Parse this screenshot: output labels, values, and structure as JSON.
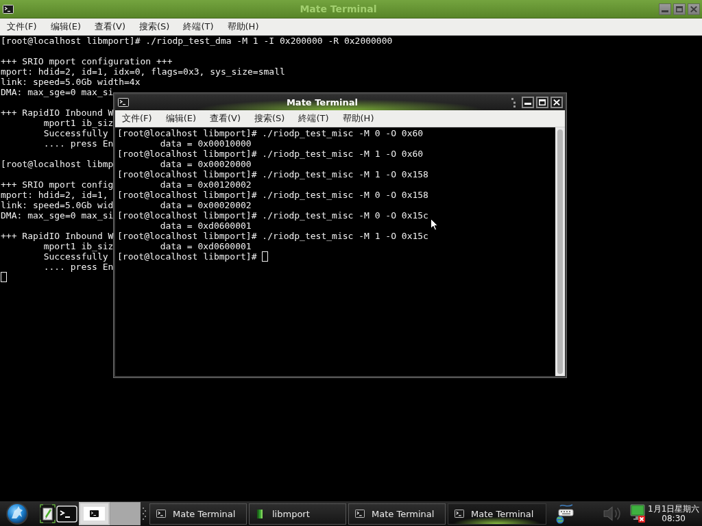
{
  "background_window": {
    "title": "Mate Terminal",
    "active": false,
    "menu": [
      "文件(F)",
      "编辑(E)",
      "查看(V)",
      "搜索(S)",
      "終端(T)",
      "帮助(H)"
    ],
    "terminal": {
      "blocks": [
        [
          "[root@localhost libmport]# ./riodp_test_dma -M 1 -I 0x200000 -R 0x2000000"
        ],
        [
          "+++ SRIO mport configuration +++",
          "mport: hdid=2, id=1, idx=0, flags=0x3, sys_size=small",
          "link: speed=5.0Gb width=4x",
          "DMA: max_sge=0 max_si"
        ],
        [
          "+++ RapidIO Inbound W",
          "        mport1 ib_siz",
          "        Successfully",
          "        .... press En"
        ],
        [
          "[root@localhost libmp"
        ],
        [
          "+++ SRIO mport config",
          "mport: hdid=2, id=1,",
          "link: speed=5.0Gb wid",
          "DMA: max_sge=0 max_si"
        ],
        [
          "+++ RapidIO Inbound W",
          "        mport1 ib_siz",
          "        Successfully",
          "        .... press En"
        ]
      ],
      "cursor": true
    }
  },
  "front_window": {
    "title": "Mate Terminal",
    "active": true,
    "menu": [
      "文件(F)",
      "编辑(E)",
      "查看(V)",
      "搜索(S)",
      "終端(T)",
      "帮助(H)"
    ],
    "terminal": {
      "blocks": [
        [
          "[root@localhost libmport]# ./riodp_test_misc -M 0 -O 0x60",
          "        data = 0x00010000",
          "[root@localhost libmport]# ./riodp_test_misc -M 1 -O 0x60",
          "        data = 0x00020000",
          "[root@localhost libmport]# ./riodp_test_misc -M 1 -O 0x158",
          "        data = 0x00120002",
          "[root@localhost libmport]# ./riodp_test_misc -M 0 -O 0x158",
          "        data = 0x00020002",
          "[root@localhost libmport]# ./riodp_test_misc -M 0 -O 0x15c",
          "        data = 0xd0600001",
          "[root@localhost libmport]# ./riodp_test_misc -M 1 -O 0x15c",
          "        data = 0xd0600001"
        ]
      ],
      "prompt": "[root@localhost libmport]#",
      "cursor": true
    }
  },
  "taskbar": {
    "launchers": [
      {
        "kind": "text_editor"
      },
      {
        "kind": "terminal"
      }
    ],
    "workspaces": [
      {
        "selected": true
      },
      {
        "selected": false
      }
    ],
    "tasks": [
      {
        "kind": "terminal",
        "label": "Mate Terminal",
        "selected": false
      },
      {
        "kind": "folder",
        "label": "libmport",
        "selected": false
      },
      {
        "kind": "terminal",
        "label": "Mate Terminal",
        "selected": false
      },
      {
        "kind": "terminal",
        "label": "Mate Terminal",
        "selected": true
      }
    ],
    "clock": {
      "date": "1月1日星期六",
      "time": "08:30"
    }
  }
}
